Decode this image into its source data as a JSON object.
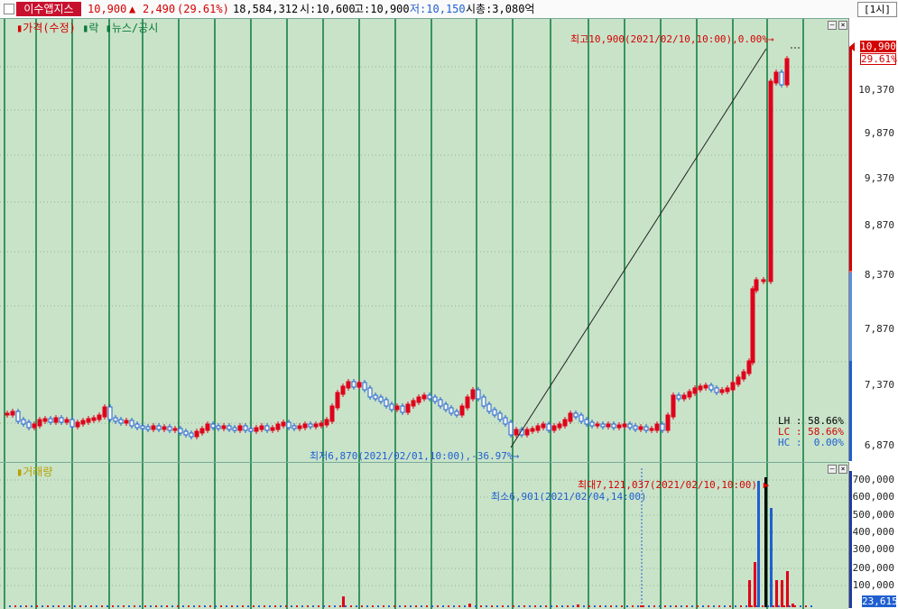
{
  "header": {
    "stock_name": "이수앱지스",
    "price": "10,900",
    "change_arrow": "up-arrow",
    "change": "2,490",
    "change_pct": "(29.61%)",
    "volume": "18,584,312",
    "open": "시:10,600",
    "high": "고:10,900",
    "low": "저:10,150",
    "market_cap": "시총:3,080억",
    "interval": "[1시]"
  },
  "price_panel": {
    "legend": {
      "price": "가격(수정)",
      "ra": "락",
      "news": "뉴스/공시"
    },
    "high_annotation": "최고10,900(2021/02/10,10:00),0.00%",
    "low_annotation": "최저6,870(2021/02/01,10:00),-36.97%",
    "stats": {
      "lh": "LH : 58.66%",
      "lc": "LC : 58.66%",
      "hc": "HC :  0.00%"
    },
    "current_price_label": "10,900",
    "current_pct_label": "29.61%",
    "axis_ticks": [
      "10,370",
      "9,870",
      "9,370",
      "8,870",
      "8,370",
      "7,870",
      "7,370",
      "6,870"
    ]
  },
  "volume_panel": {
    "legend": "거래량",
    "max_annotation": "최대7,121,037(2021/02/10,10:00)",
    "min_annotation": "최소6,901(2021/02/04,14:00)",
    "axis_ticks": [
      "700,000",
      "600,000",
      "500,000",
      "400,000",
      "300,000",
      "200,000",
      "100,000"
    ],
    "current_volume_label": "23,615"
  },
  "colors": {
    "up": "#e0001b",
    "down": "#1f5fd0",
    "background": "#c9e3c9",
    "divider": "#0a7a3a",
    "header_red": "#c8102e"
  }
}
